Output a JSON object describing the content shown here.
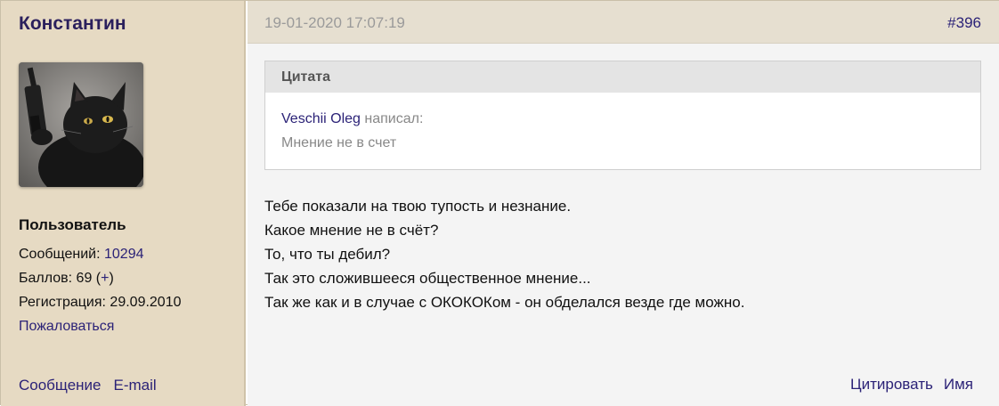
{
  "user": {
    "name": "Константин",
    "rank": "Пользователь",
    "messages_label": "Сообщений: ",
    "messages_count": "10294",
    "points_label": "Баллов: 69 (",
    "points_plus": "+",
    "points_close": ")",
    "registration": "Регистрация: 29.09.2010",
    "report_link": "Пожаловаться",
    "message_link": "Сообщение",
    "email_link": "E-mail"
  },
  "post": {
    "date": "19-01-2020 17:07:19",
    "number": "#396",
    "quote": {
      "header": "Цитата",
      "author": "Veschii Oleg",
      "wrote": " написал:",
      "text": "Мнение не в счет"
    },
    "lines": [
      "Тебе показали на твою тупость и незнание.",
      "Какое мнение не в счёт?",
      "То, что ты дебил?",
      "Так это сложившееся общественное мнение...",
      "Так же как и в случае с ОКОКОКом - он обделался везде где можно."
    ],
    "actions": {
      "quote": "Цитировать",
      "name": "Имя"
    }
  },
  "colors": {
    "sidebar_bg": "#e6dac3",
    "header_bg": "#e6dfd0",
    "link": "#2b2277",
    "content_bg": "#f4f4f4"
  }
}
